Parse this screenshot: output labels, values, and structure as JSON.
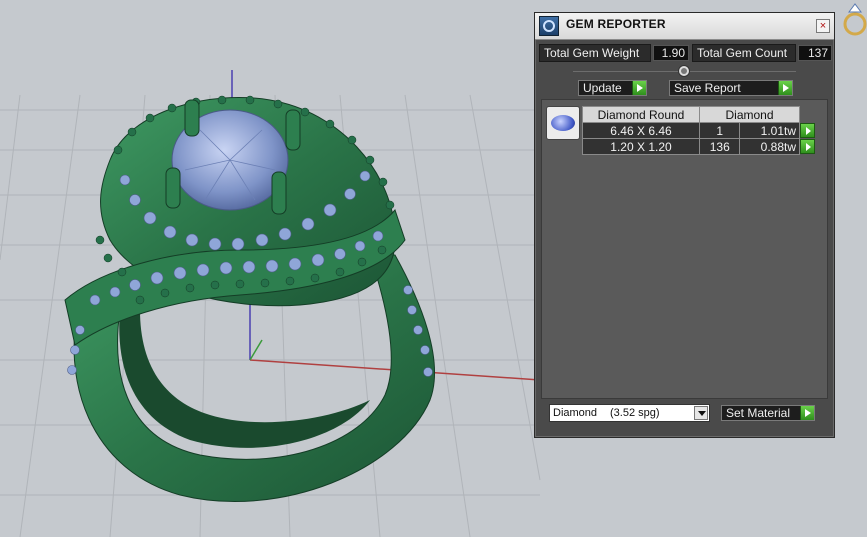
{
  "panel": {
    "title": "GEM REPORTER",
    "close_glyph": "×",
    "total_weight_label": "Total Gem Weight",
    "total_weight_value": "1.90",
    "total_count_label": "Total Gem Count",
    "total_count_value": "137",
    "update_label": "Update",
    "save_report_label": "Save Report"
  },
  "table": {
    "header": {
      "shape": "Diamond Round",
      "material": "Diamond"
    },
    "rows": [
      {
        "size": "6.46 X 6.46",
        "count": "1",
        "weight": "1.01tw"
      },
      {
        "size": "1.20 X 1.20",
        "count": "136",
        "weight": "0.88tw"
      }
    ]
  },
  "material_select": {
    "name": "Diamond",
    "spg": "(3.52 spg)"
  },
  "set_material_label": "Set Material",
  "icons": {
    "title": "gem-reporter-icon",
    "close": "close-icon",
    "gem_thumb": "diamond-icon",
    "corner": "ring-icon",
    "arrows": "play-arrow-icon"
  },
  "colors": {
    "panel_bg": "#4a4a4a",
    "ring_green": "#2c7a4e",
    "gem_blue": "#8da3d6",
    "accent_green": "#3db01f"
  }
}
